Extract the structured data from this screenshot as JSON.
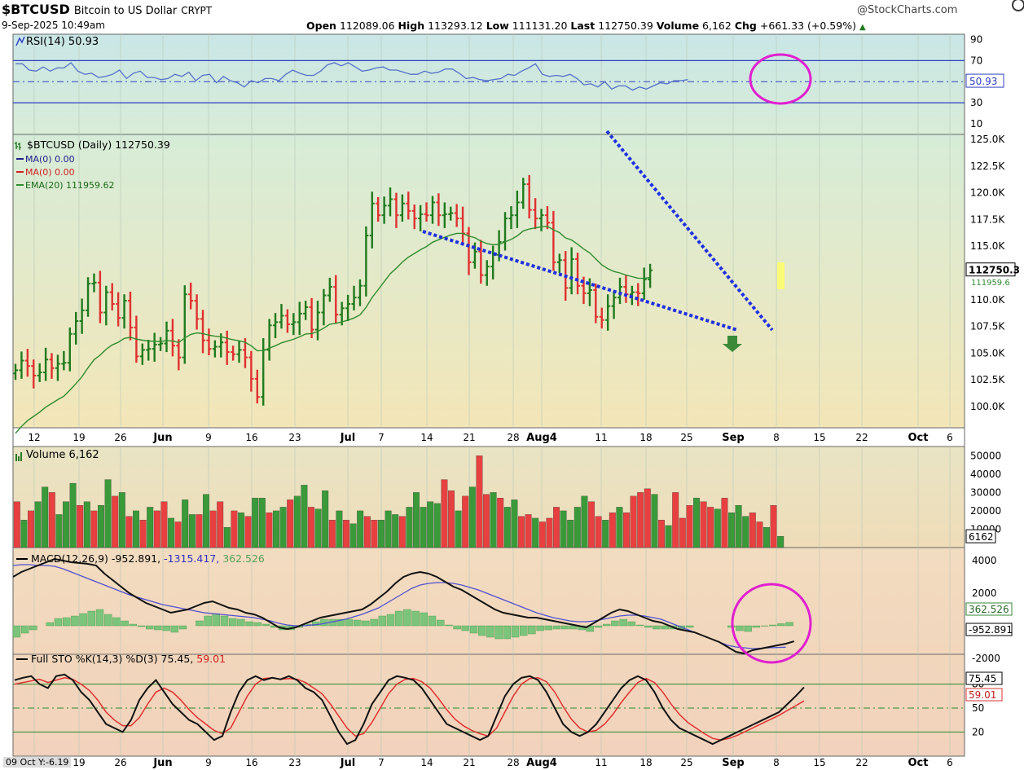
{
  "header": {
    "symbol": "$BTCUSD",
    "name": "Bitcoin to US Dollar",
    "exchange": "CRYPT",
    "watermark": "@StockCharts.com",
    "datetime": "9-Sep-2025 10:49am",
    "open_label": "Open",
    "open": "112089.06",
    "high_label": "High",
    "high": "113293.12",
    "low_label": "Low",
    "low": "111131.20",
    "last_label": "Last",
    "last": "112750.39",
    "volume_label": "Volume",
    "volume": "6,162",
    "chg_label": "Chg",
    "chg": "+661.33 (+0.59%)",
    "footer_note": "09 Oct Y:-6.19"
  },
  "colors": {
    "up": "#1e7a1e",
    "down": "#e03030",
    "rsi": "#5570c8",
    "ema": "#2e8b2e",
    "trend": "#1f2fe0",
    "circle": "#e020d0",
    "vol_up": "#3a9a3a",
    "vol_down": "#e84040",
    "hist": "#7cc47c",
    "macd": "#111111",
    "signal": "#5050d0",
    "sto_k": "#111111",
    "sto_d": "#e03030",
    "arrow": "#3a8a3a"
  },
  "chart_data": [
    {
      "panel": "rsi",
      "type": "line",
      "legend": "RSI(14) 50.93",
      "current": "50.93",
      "ylim": [
        0,
        100
      ],
      "y_ticks": [
        "90",
        "70",
        "30",
        "10"
      ],
      "guide_lines": [
        70,
        50,
        30
      ],
      "series": [
        {
          "values": [
            67,
            67,
            61,
            60,
            64,
            60,
            63,
            63,
            68,
            60,
            57,
            58,
            54,
            55,
            57,
            61,
            53,
            58,
            60,
            54,
            54,
            52,
            53,
            57,
            55,
            59,
            51,
            56,
            57,
            49,
            55,
            51,
            49,
            45,
            51,
            49,
            53,
            53,
            51,
            57,
            61,
            58,
            56,
            56,
            60,
            66,
            68,
            65,
            68,
            64,
            60,
            61,
            63,
            64,
            61,
            61,
            59,
            57,
            57,
            60,
            58,
            59,
            62,
            62,
            58,
            53,
            54,
            52,
            51,
            52,
            53,
            57,
            56,
            60,
            63,
            67,
            57,
            55,
            56,
            55,
            57,
            53,
            47,
            48,
            45,
            50,
            43,
            46,
            46,
            42,
            45,
            43,
            46,
            49,
            48,
            51,
            51,
            52
          ]
        }
      ]
    },
    {
      "panel": "price",
      "type": "ohlc",
      "legend": [
        "$BTCUSD (Daily) 112750.39",
        "MA(0) 0.00",
        "MA(0) 0.00",
        "EMA(20) 111959.62"
      ],
      "ylim": [
        97500,
        127500
      ],
      "y_ticks": [
        "125.0K",
        "122.5K",
        "120.0K",
        "117.5K",
        "115.0K",
        "112.5K",
        "110.0K",
        "107.5K",
        "105.0K",
        "102.5K",
        "100.0K"
      ],
      "last_label": "112750.3",
      "ema_label": "111959.6",
      "x_ticks": [
        "12",
        "19",
        "26",
        "Jun",
        "9",
        "16",
        "23",
        "Jul",
        "7",
        "14",
        "21",
        "28",
        "Aug4",
        "11",
        "18",
        "25",
        "Sep",
        "8",
        "15",
        "22",
        "Oct",
        "6"
      ],
      "closes": [
        103.4,
        104.3,
        103.8,
        102.9,
        103.2,
        104.4,
        103.6,
        104.0,
        104.1,
        106.8,
        108.0,
        109.0,
        111.5,
        111.6,
        108.8,
        110.7,
        109.6,
        108.3,
        109.9,
        107.4,
        104.7,
        105.3,
        105.4,
        105.8,
        105.9,
        107.1,
        105.7,
        104.6,
        110.5,
        109.9,
        108.2,
        106.2,
        105.4,
        105.6,
        106.0,
        105.1,
        104.9,
        105.3,
        104.6,
        102.6,
        100.9,
        105.3,
        107.6,
        107.9,
        108.5,
        107.7,
        107.9,
        108.7,
        109.3,
        107.2,
        108.8,
        110.4,
        111.2,
        108.6,
        109.2,
        109.6,
        110.2,
        111.3,
        116.0,
        119.0,
        117.9,
        118.8,
        119.4,
        117.9,
        119.0,
        118.3,
        117.6,
        118.0,
        117.9,
        119.1,
        117.9,
        118.0,
        118.1,
        117.6,
        116.2,
        113.5,
        114.5,
        112.3,
        113.1,
        114.2,
        115.4,
        117.6,
        117.9,
        119.1,
        120.8,
        118.4,
        117.6,
        117.9,
        117.2,
        113.5,
        113.7,
        111.1,
        113.8,
        111.3,
        110.6,
        110.9,
        108.4,
        108.1,
        109.4,
        110.2,
        111.2,
        110.5,
        110.7,
        110.6,
        111.9,
        112.75
      ]
    },
    {
      "panel": "volume",
      "type": "bar",
      "legend": "Volume 6,162",
      "current": "6162",
      "ylim": [
        0,
        55000
      ],
      "y_ticks": [
        "50000",
        "40000",
        "30000",
        "20000",
        "10000"
      ],
      "values": [
        25000,
        15000,
        20000,
        25000,
        33000,
        30000,
        18000,
        25000,
        35000,
        23000,
        25000,
        20000,
        23000,
        37000,
        28000,
        30000,
        17000,
        20000,
        15000,
        22000,
        20000,
        25000,
        16000,
        14000,
        26000,
        18000,
        18000,
        29000,
        20000,
        25000,
        11000,
        20000,
        19000,
        17000,
        27000,
        27000,
        19000,
        20000,
        22000,
        26000,
        28000,
        34000,
        22000,
        21000,
        31000,
        15000,
        20000,
        15000,
        13000,
        20000,
        17000,
        15000,
        15000,
        20000,
        18000,
        17000,
        22000,
        30000,
        22000,
        25000,
        24000,
        37000,
        31000,
        20000,
        28000,
        33000,
        50000,
        29000,
        30000,
        27000,
        22000,
        26000,
        17000,
        18000,
        16000,
        14000,
        16000,
        22000,
        20000,
        15000,
        22000,
        28000,
        25000,
        17000,
        15000,
        19000,
        22000,
        19000,
        28000,
        30000,
        32000,
        29000,
        15000,
        12000,
        30000,
        16000,
        23000,
        27000,
        25000,
        22000,
        21000,
        27000,
        19000,
        23000,
        17000,
        19000,
        14000,
        11000,
        23000,
        6162
      ],
      "up": [
        0,
        1,
        0,
        1,
        1,
        0,
        1,
        1,
        1,
        0,
        1,
        0,
        1,
        1,
        0,
        1,
        0,
        1,
        0,
        1,
        0,
        0,
        1,
        0,
        1,
        1,
        0,
        1,
        0,
        0,
        1,
        0,
        1,
        0,
        1,
        1,
        0,
        1,
        1,
        0,
        1,
        1,
        0,
        1,
        1,
        0,
        1,
        0,
        1,
        1,
        0,
        0,
        1,
        1,
        1,
        0,
        1,
        1,
        1,
        1,
        1,
        0,
        0,
        1,
        0,
        1,
        0,
        0,
        1,
        0,
        1,
        1,
        0,
        0,
        1,
        0,
        0,
        0,
        1,
        1,
        1,
        1,
        0,
        0,
        1,
        0,
        1,
        0,
        0,
        0,
        0,
        1,
        0,
        1,
        0,
        0,
        0,
        1,
        0,
        0,
        1,
        0,
        1,
        1,
        1,
        0,
        0,
        1,
        0,
        1
      ]
    },
    {
      "panel": "macd",
      "type": "line",
      "legend_prefix": "MACD(12,26,9)",
      "macd_value": "-952.891",
      "signal_value": "-1315.417",
      "hist_value": "362.526",
      "ylim": [
        -2500,
        5000
      ],
      "y_ticks": [
        "4000",
        "2000",
        "-2000"
      ],
      "labels": [
        "362.526",
        "-952.891"
      ],
      "macd": [
        3000,
        3300,
        3500,
        3700,
        3900,
        4100,
        4000,
        3900,
        3850,
        3800,
        3700,
        3200,
        2800,
        2400,
        2000,
        1700,
        1400,
        1200,
        1000,
        800,
        900,
        1000,
        1200,
        1400,
        1500,
        1300,
        1100,
        1000,
        800,
        700,
        500,
        200,
        -100,
        -200,
        -100,
        100,
        300,
        500,
        600,
        700,
        800,
        900,
        1000,
        1300,
        1700,
        2100,
        2600,
        3000,
        3200,
        3300,
        3200,
        3000,
        2700,
        2400,
        2200,
        1900,
        1600,
        1300,
        1000,
        800,
        700,
        600,
        500,
        500,
        400,
        300,
        200,
        100,
        0,
        -100,
        200,
        500,
        800,
        1000,
        900,
        700,
        500,
        300,
        200,
        0,
        -200,
        -300,
        -400,
        -600,
        -800,
        -1000,
        -1300,
        -1600,
        -1700,
        -1500,
        -1400,
        -1300,
        -1200,
        -1100,
        -953
      ],
      "signal": [
        3700,
        3750,
        3750,
        3700,
        3700,
        3650,
        3500,
        3300,
        3100,
        2900,
        2700,
        2500,
        2300,
        2100,
        1900,
        1750,
        1600,
        1450,
        1300,
        1200,
        1100,
        1000,
        900,
        800,
        750,
        700,
        650,
        600,
        550,
        500,
        400,
        300,
        150,
        50,
        0,
        0,
        50,
        100,
        200,
        300,
        400,
        550,
        700,
        900,
        1100,
        1400,
        1700,
        2000,
        2300,
        2500,
        2600,
        2650,
        2650,
        2600,
        2500,
        2350,
        2200,
        2000,
        1800,
        1600,
        1400,
        1200,
        1000,
        800,
        650,
        500,
        400,
        300,
        250,
        250,
        300,
        400,
        500,
        600,
        650,
        650,
        600,
        500,
        400,
        200,
        0,
        -200,
        -400,
        -600,
        -800,
        -1000,
        -1200,
        -1300,
        -1350,
        -1400,
        -1380,
        -1350,
        -1330,
        -1315
      ]
    },
    {
      "panel": "sto",
      "type": "line",
      "legend_prefix": "Full STO %K(14,3) %D(3)",
      "k_value": "75.45",
      "d_value": "59.01",
      "ylim": [
        0,
        100
      ],
      "y_ticks": [
        "80",
        "50",
        "20"
      ],
      "labels": [
        "75.45",
        "59.01"
      ],
      "k": [
        85,
        88,
        90,
        80,
        75,
        90,
        92,
        85,
        70,
        60,
        45,
        30,
        25,
        20,
        35,
        60,
        75,
        85,
        70,
        55,
        45,
        35,
        30,
        20,
        10,
        15,
        45,
        70,
        85,
        90,
        85,
        88,
        86,
        90,
        85,
        75,
        70,
        60,
        40,
        20,
        5,
        10,
        30,
        55,
        70,
        85,
        90,
        88,
        85,
        75,
        60,
        45,
        30,
        25,
        20,
        15,
        10,
        15,
        40,
        65,
        80,
        88,
        90,
        85,
        70,
        50,
        30,
        20,
        15,
        20,
        30,
        45,
        60,
        75,
        85,
        90,
        85,
        70,
        50,
        35,
        25,
        20,
        15,
        10,
        5,
        10,
        15,
        20,
        25,
        30,
        35,
        40,
        45,
        55,
        65,
        76
      ],
      "d": [
        80,
        82,
        84,
        86,
        82,
        85,
        88,
        86,
        80,
        72,
        60,
        45,
        35,
        28,
        28,
        38,
        55,
        70,
        75,
        70,
        60,
        48,
        38,
        30,
        22,
        18,
        25,
        45,
        65,
        80,
        87,
        88,
        86,
        87,
        86,
        82,
        75,
        68,
        55,
        40,
        25,
        15,
        18,
        32,
        50,
        68,
        80,
        86,
        87,
        83,
        75,
        62,
        48,
        36,
        28,
        22,
        18,
        15,
        25,
        45,
        65,
        80,
        87,
        88,
        83,
        70,
        52,
        36,
        25,
        20,
        22,
        30,
        42,
        57,
        70,
        82,
        87,
        82,
        70,
        55,
        42,
        32,
        25,
        18,
        12,
        10,
        12,
        16,
        21,
        26,
        31,
        36,
        41,
        47,
        53,
        59
      ]
    }
  ]
}
